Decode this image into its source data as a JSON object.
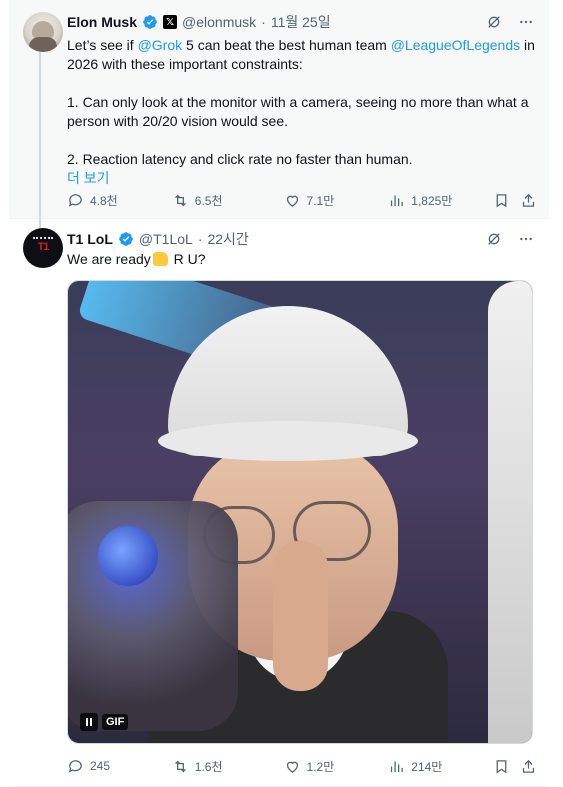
{
  "quoted_tweet": {
    "author_name": "Elon Musk",
    "handle": "@elonmusk",
    "separator": "·",
    "date": "11월 25일",
    "text_parts": {
      "line1_prefix": "Let’s see if ",
      "mention_grok": "@Grok",
      "line1_middle": " 5 can beat the best human team ",
      "mention_lol": "@LeagueOfLegends",
      "line1_suffix": " in 2026 with these important constraints:",
      "point1": "1. Can only look at the monitor with a camera, seeing no more than what a person with 20/20 vision would see.",
      "point2": "2. Reaction latency and click rate no faster than human."
    },
    "show_more": "더 보기",
    "stats": {
      "replies": "4.8천",
      "reposts": "6.5천",
      "likes": "7.1만",
      "views": "1,825만"
    }
  },
  "reply_tweet": {
    "author_name": "T1 LoL",
    "handle": "@T1LoL",
    "separator": "·",
    "time": "22시간",
    "text_before": "We are ready",
    "text_after": " R U?",
    "media_badge": "GIF",
    "stats": {
      "replies": "245",
      "reposts": "1.6천",
      "likes": "1.2만",
      "views": "214만"
    }
  },
  "colors": {
    "link": "#1d9bf0",
    "secondary_text": "#536471",
    "verified": "#1d9bf0",
    "quoted_bg": "#f7f9f9"
  }
}
